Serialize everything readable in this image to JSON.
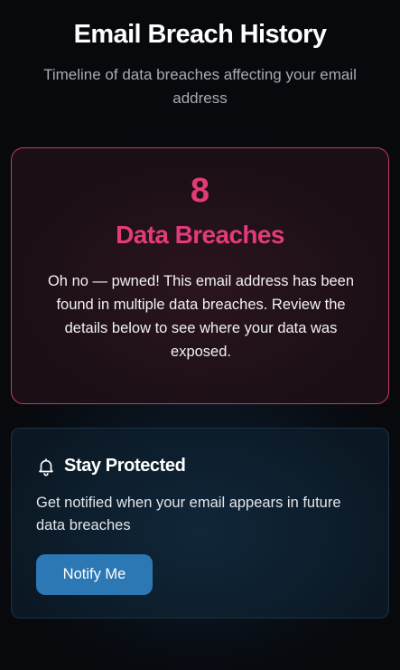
{
  "header": {
    "title": "Email Breach History",
    "subtitle": "Timeline of data breaches affecting your email address"
  },
  "breach_summary": {
    "count": "8",
    "label": "Data Breaches",
    "description": "Oh no — pwned! This email address has been found in multiple data breaches. Review the details below to see where your data was exposed.",
    "accent_color": "#e23b78"
  },
  "protection": {
    "icon": "bell-icon",
    "title": "Stay Protected",
    "description": "Get notified when your email appears in future data breaches",
    "button_label": "Notify Me",
    "button_color": "#2c78b4"
  }
}
